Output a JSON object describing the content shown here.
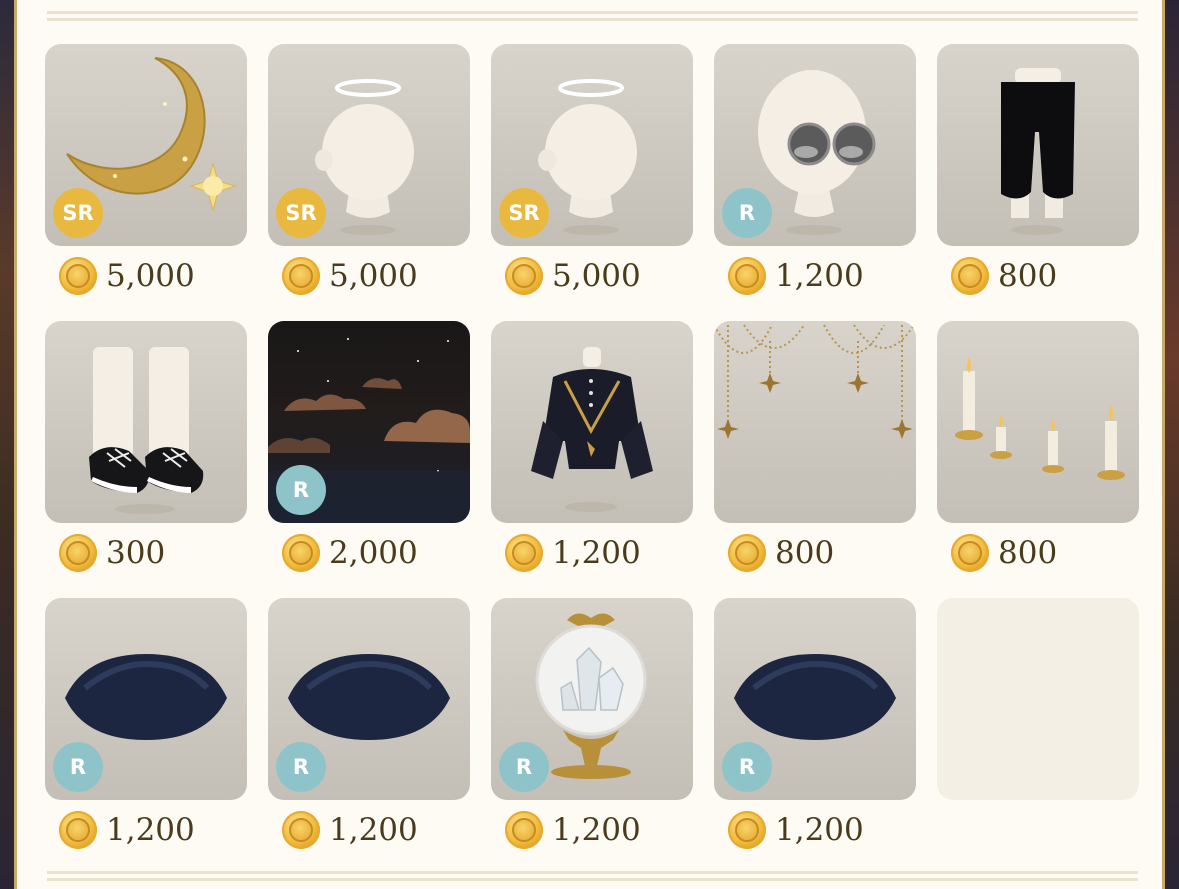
{
  "shop": {
    "items": [
      {
        "kind": "crescent-moon",
        "rarity": "SR",
        "price": "5,000"
      },
      {
        "kind": "halo-head",
        "rarity": "SR",
        "price": "5,000"
      },
      {
        "kind": "halo-head",
        "rarity": "SR",
        "price": "5,000"
      },
      {
        "kind": "round-sunglasses",
        "rarity": "R",
        "price": "1,200"
      },
      {
        "kind": "black-pants",
        "rarity": "",
        "price": "800"
      },
      {
        "kind": "sneakers",
        "rarity": "",
        "price": "300"
      },
      {
        "kind": "night-clouds",
        "rarity": "R",
        "price": "2,000"
      },
      {
        "kind": "dark-coat",
        "rarity": "",
        "price": "1,200"
      },
      {
        "kind": "star-garland",
        "rarity": "",
        "price": "800"
      },
      {
        "kind": "candles",
        "rarity": "",
        "price": "800"
      },
      {
        "kind": "navy-cushion",
        "rarity": "R",
        "price": "1,200"
      },
      {
        "kind": "navy-cushion",
        "rarity": "R",
        "price": "1,200"
      },
      {
        "kind": "crystal-globe",
        "rarity": "R",
        "price": "1,200"
      },
      {
        "kind": "navy-cushion",
        "rarity": "R",
        "price": "1,200"
      },
      {
        "kind": "empty-slot",
        "rarity": "",
        "price": ""
      }
    ]
  },
  "colors": {
    "sr_badge": "#e9b83f",
    "r_badge": "#8ec4c9",
    "price_text": "#4a3b1c",
    "coin": "#efba3a",
    "panel": "#fdfbf3"
  },
  "icons": {
    "currency": "gold-coin-icon"
  }
}
